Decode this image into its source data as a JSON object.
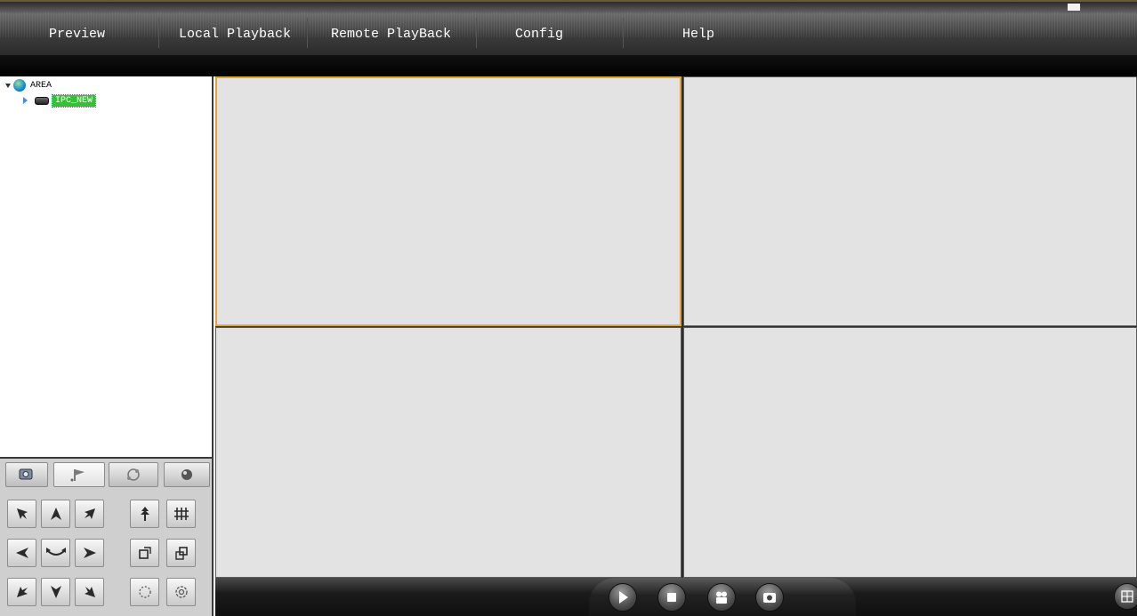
{
  "menu": {
    "items": [
      "Preview",
      "Local Playback",
      "Remote PlayBack",
      "Config",
      "Help"
    ]
  },
  "tree": {
    "root_label": "AREA",
    "child_label": "IPC_NEW"
  },
  "ptz": {
    "tabs": [
      "ptz-control-tab-icon",
      "preset-flag-tab-icon",
      "cruise-tab-icon",
      "track-tab-icon"
    ]
  },
  "video_grid": {
    "layout": "2x2",
    "selected_cell": 1
  },
  "controls": {
    "buttons": [
      "play-icon",
      "stop-icon",
      "record-icon",
      "snapshot-icon",
      "layout-icon"
    ]
  },
  "colors": {
    "selected_border": "#e6a236",
    "tree_highlight": "#34c234",
    "menu_text": "#ffffff"
  }
}
